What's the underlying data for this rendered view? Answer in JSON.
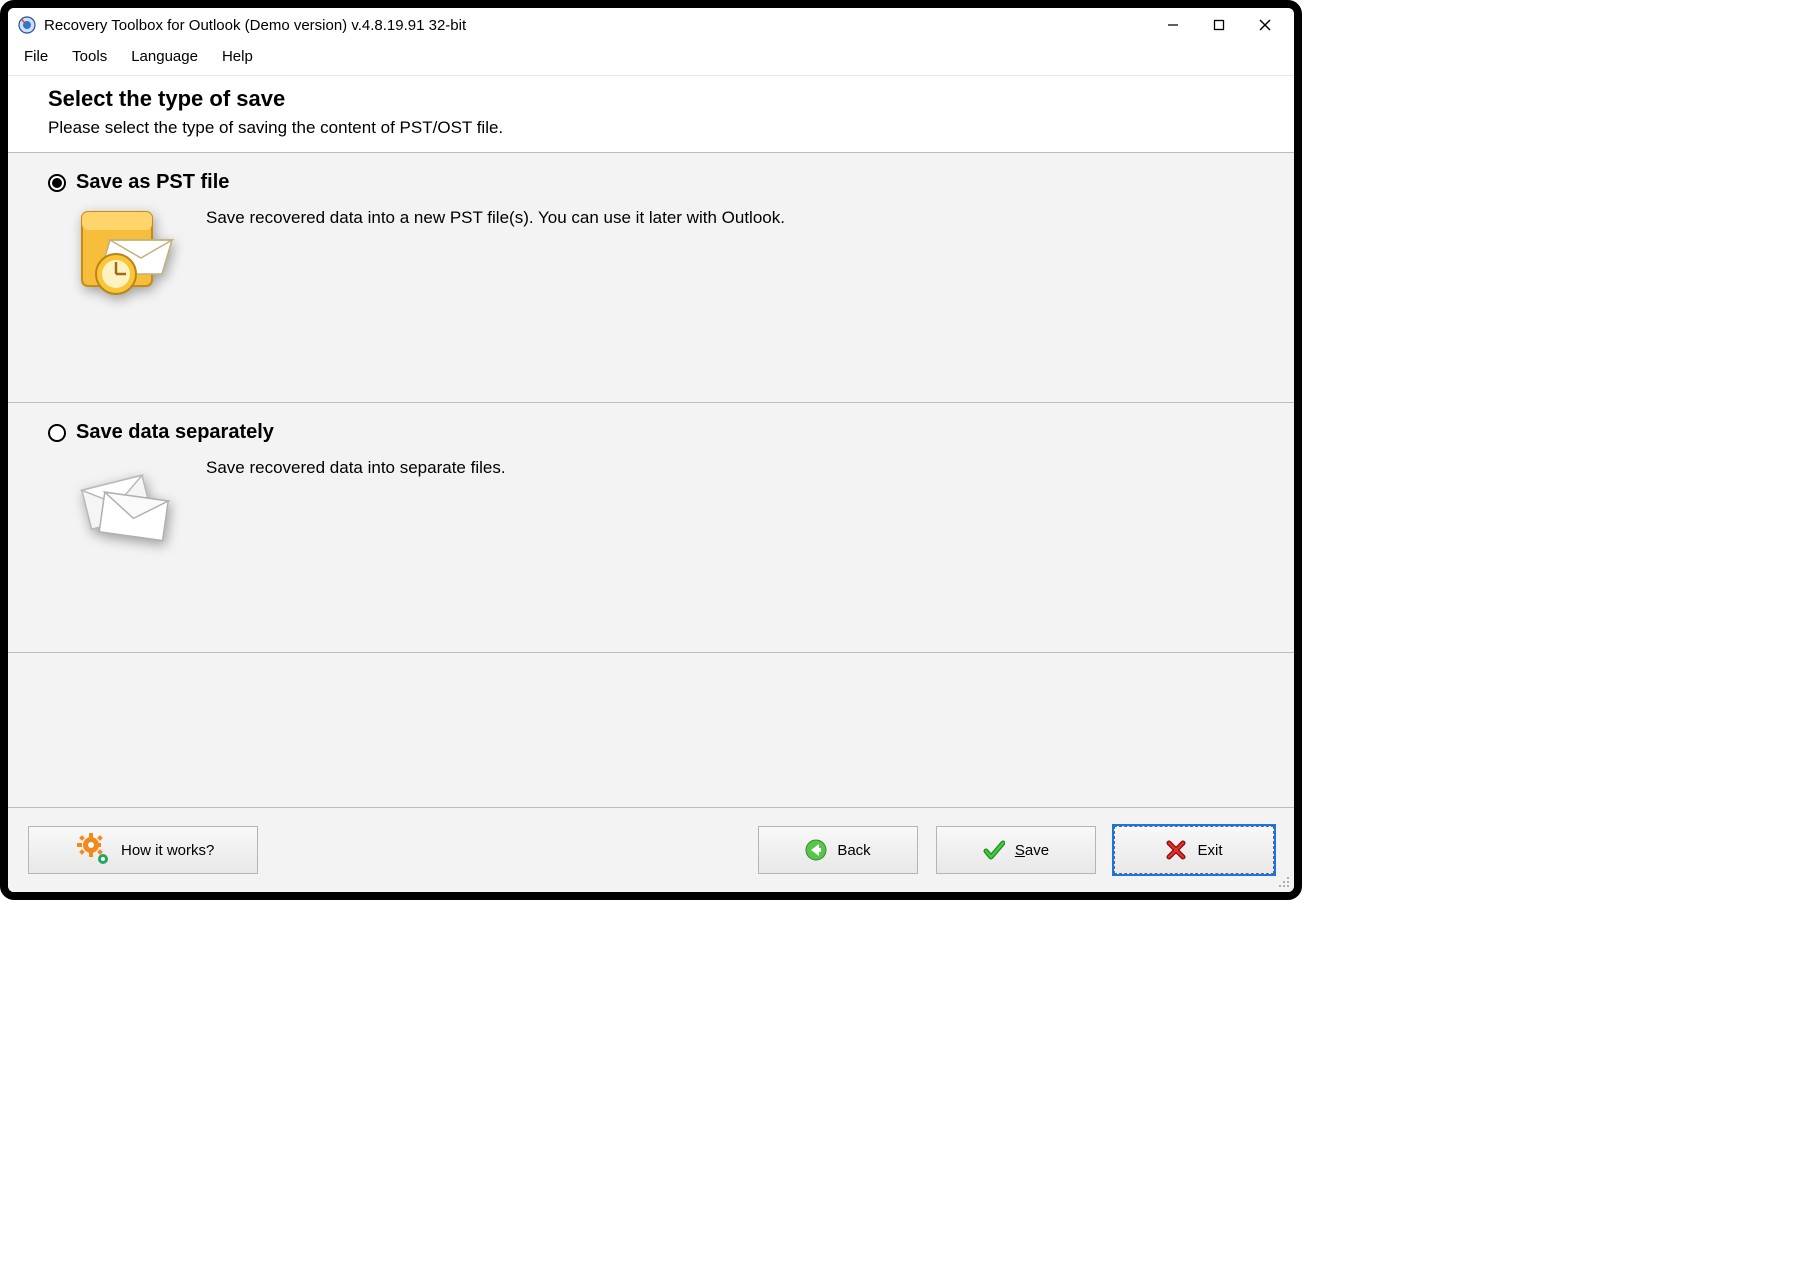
{
  "window": {
    "title": "Recovery Toolbox for Outlook (Demo version) v.4.8.19.91 32-bit"
  },
  "menu": {
    "file": "File",
    "tools": "Tools",
    "language": "Language",
    "help": "Help"
  },
  "header": {
    "title": "Select the type of save",
    "subtitle": "Please select the type of saving the content of PST/OST file."
  },
  "options": {
    "pst": {
      "selected": true,
      "title": "Save as PST file",
      "desc": "Save recovered data into a new PST file(s). You can use it later with Outlook."
    },
    "separate": {
      "selected": false,
      "title": "Save data separately",
      "desc": "Save recovered data into separate files."
    }
  },
  "buttons": {
    "how_it_works": "How it works?",
    "back": "Back",
    "save": "Save",
    "exit": "Exit"
  }
}
